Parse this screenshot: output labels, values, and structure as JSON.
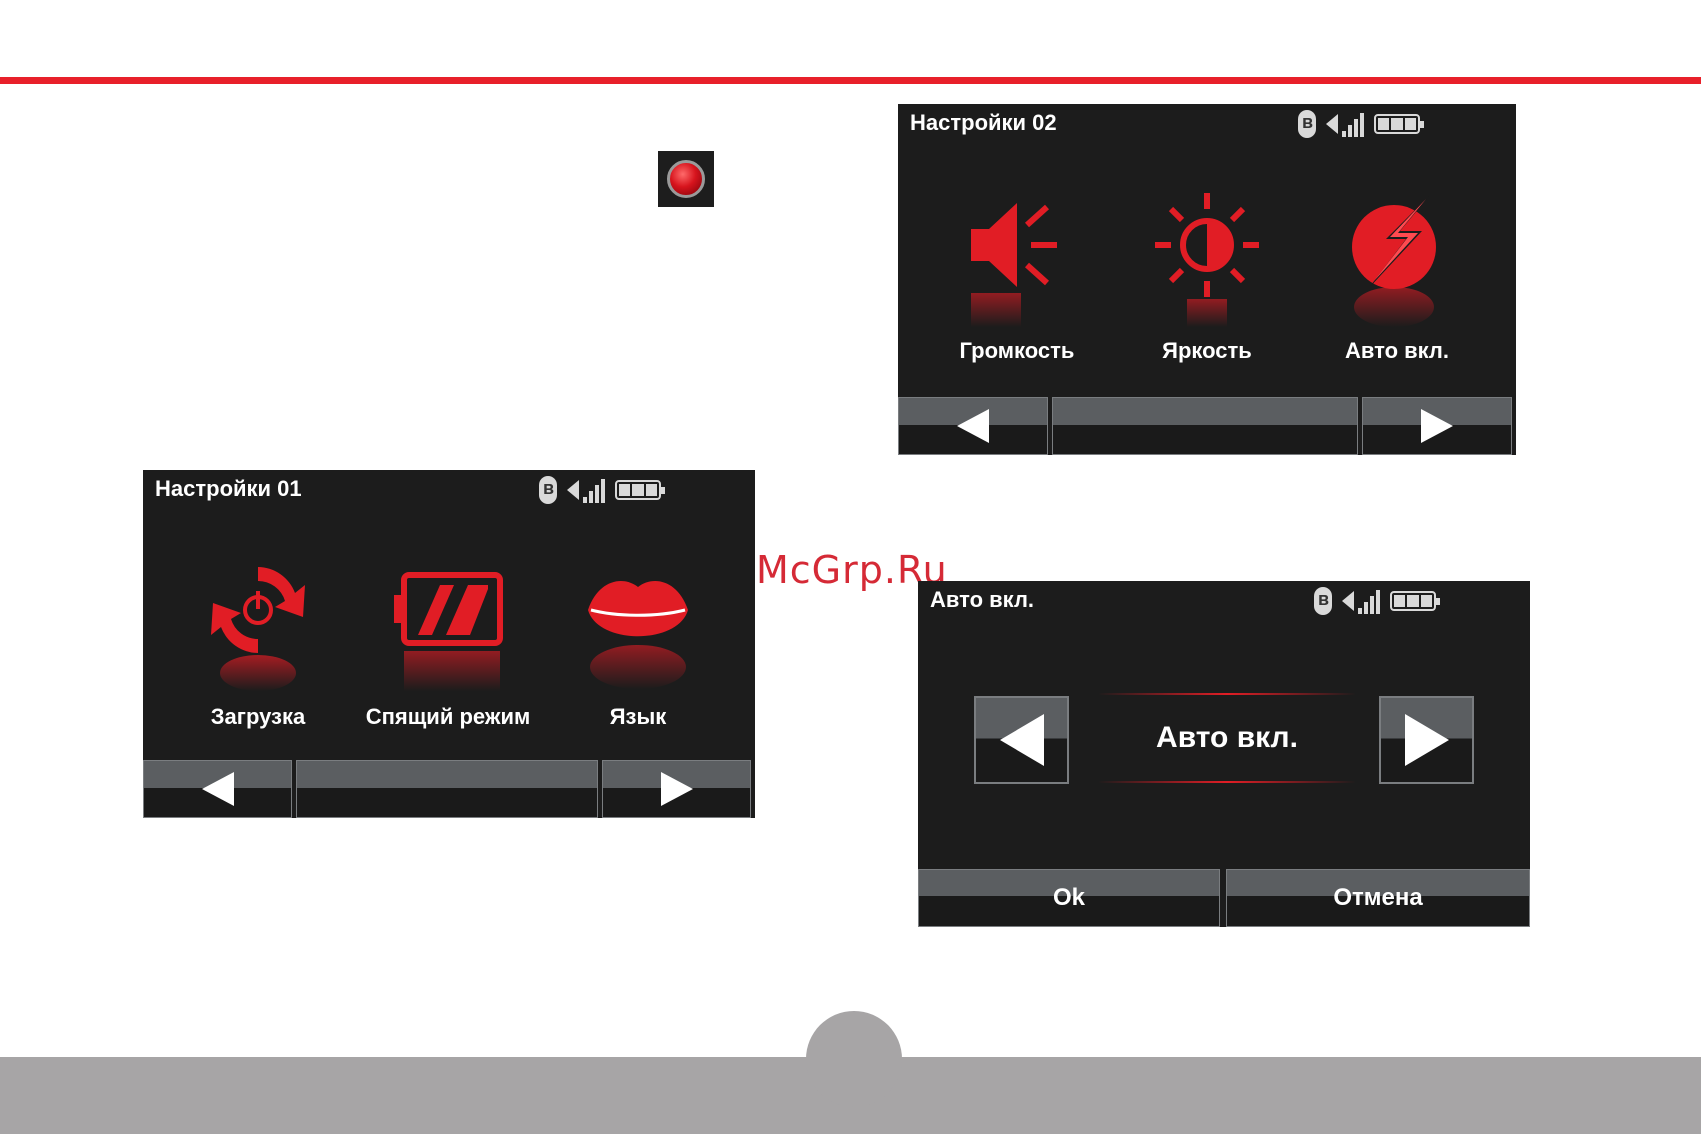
{
  "page": {
    "watermark": "McGrp.Ru",
    "colors": {
      "accent": "#e8202a",
      "screen_bg": "#1c1c1c",
      "footer": "#a7a5a6"
    }
  },
  "screen1": {
    "title": "Настройки 01",
    "items": [
      {
        "label": "Загрузка",
        "icon": "reload-power-icon"
      },
      {
        "label": "Спящий режим",
        "icon": "battery-sleep-icon"
      },
      {
        "label": "Язык",
        "icon": "lips-icon"
      }
    ]
  },
  "screen2": {
    "title": "Настройки 02",
    "items": [
      {
        "label": "Громкость",
        "icon": "speaker-icon"
      },
      {
        "label": "Яркость",
        "icon": "brightness-icon"
      },
      {
        "label": "Авто вкл.",
        "icon": "lightning-icon"
      }
    ]
  },
  "screen3": {
    "title": "Авто вкл.",
    "value": "Авто вкл.",
    "ok_label": "Ok",
    "cancel_label": "Отмена"
  }
}
